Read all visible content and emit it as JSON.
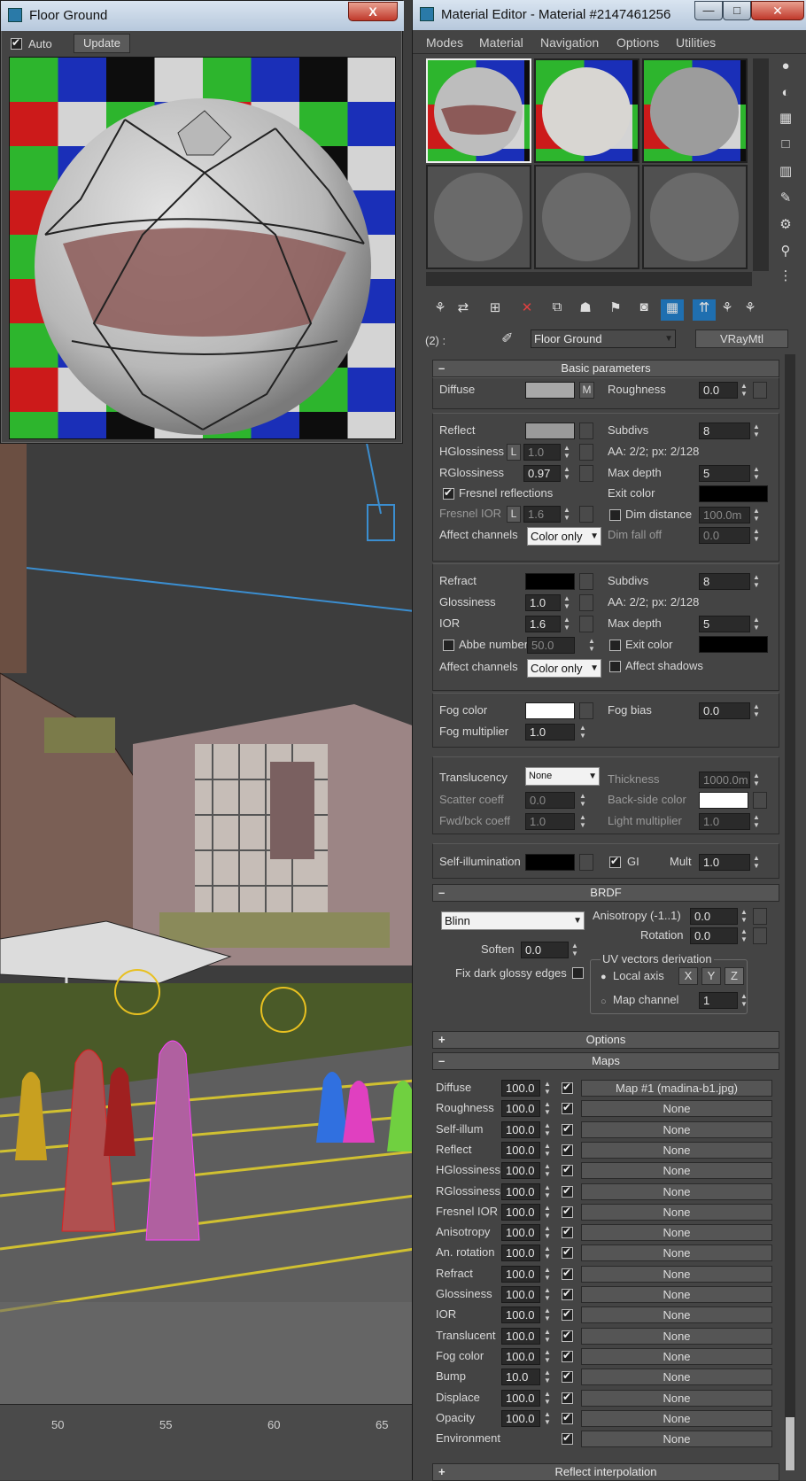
{
  "floor_window": {
    "title": "Floor Ground",
    "close_label": "X",
    "auto_label": "Auto",
    "auto_checked": true,
    "update_label": "Update"
  },
  "material_editor": {
    "title": "Material Editor - Material #2147461256",
    "controls": {
      "minimize": "—",
      "maximize": "□",
      "close": "✕"
    },
    "menu": [
      "Modes",
      "Material",
      "Navigation",
      "Options",
      "Utilities"
    ],
    "slot_label": "(2) :",
    "material_name": "Floor Ground",
    "material_type": "VRayMtl"
  },
  "basic_parameters": {
    "header": "Basic parameters",
    "diffuse": {
      "label": "Diffuse",
      "map_btn": "M",
      "roughness_label": "Roughness",
      "roughness": "0.0"
    },
    "reflect": {
      "label": "Reflect",
      "subdivs_label": "Subdivs",
      "subdivs": "8",
      "hglossiness_label": "HGlossiness",
      "lock": "L",
      "hglossiness": "1.0",
      "aa": "AA: 2/2; px: 2/128",
      "rglossiness_label": "RGlossiness",
      "rglossiness": "0.97",
      "max_depth_label": "Max depth",
      "max_depth": "5",
      "fresnel_label": "Fresnel reflections",
      "fresnel_checked": true,
      "exit_color_label": "Exit color",
      "fresnel_ior_label": "Fresnel IOR",
      "fresnel_ior": "1.6",
      "dim_distance_label": "Dim distance",
      "dim_distance": "100.0m",
      "affect_channels_label": "Affect channels",
      "affect_channels": "Color only",
      "dim_falloff_label": "Dim fall off",
      "dim_falloff": "0.0"
    },
    "refract": {
      "label": "Refract",
      "subdivs_label": "Subdivs",
      "subdivs": "8",
      "glossiness_label": "Glossiness",
      "glossiness": "1.0",
      "aa": "AA: 2/2; px: 2/128",
      "ior_label": "IOR",
      "ior": "1.6",
      "max_depth_label": "Max depth",
      "max_depth": "5",
      "abbe_label": "Abbe number",
      "abbe": "50.0",
      "exit_color_label": "Exit color",
      "affect_channels_label": "Affect channels",
      "affect_channels": "Color only",
      "affect_shadows_label": "Affect shadows"
    },
    "fog": {
      "color_label": "Fog color",
      "bias_label": "Fog bias",
      "bias": "0.0",
      "multiplier_label": "Fog multiplier",
      "multiplier": "1.0"
    },
    "translucency": {
      "label": "Translucency",
      "value": "None",
      "thickness_label": "Thickness",
      "thickness": "1000.0m",
      "scatter_label": "Scatter coeff",
      "scatter": "0.0",
      "backside_label": "Back-side color",
      "fwd_label": "Fwd/bck coeff",
      "fwd": "1.0",
      "light_mult_label": "Light multiplier",
      "light_mult": "1.0"
    },
    "self_illum": {
      "label": "Self-illumination",
      "gi_label": "GI",
      "gi_checked": true,
      "mult_label": "Mult",
      "mult": "1.0"
    }
  },
  "brdf": {
    "header": "BRDF",
    "type": "Blinn",
    "anisotropy_label": "Anisotropy (-1..1)",
    "anisotropy": "0.0",
    "rotation_label": "Rotation",
    "rotation": "0.0",
    "soften_label": "Soften",
    "soften": "0.0",
    "fix_dark_label": "Fix dark glossy edges",
    "uv_label": "UV vectors derivation",
    "local_axis_label": "Local axis",
    "axes": [
      "X",
      "Y",
      "Z"
    ],
    "map_channel_label": "Map channel",
    "map_channel": "1"
  },
  "options": {
    "header": "Options"
  },
  "maps": {
    "header": "Maps",
    "rows": [
      {
        "name": "Diffuse",
        "amount": "100.0",
        "map": "Map #1 (madina-b1.jpg)"
      },
      {
        "name": "Roughness",
        "amount": "100.0",
        "map": "None"
      },
      {
        "name": "Self-illum",
        "amount": "100.0",
        "map": "None"
      },
      {
        "name": "Reflect",
        "amount": "100.0",
        "map": "None"
      },
      {
        "name": "HGlossiness",
        "amount": "100.0",
        "map": "None"
      },
      {
        "name": "RGlossiness",
        "amount": "100.0",
        "map": "None"
      },
      {
        "name": "Fresnel IOR",
        "amount": "100.0",
        "map": "None"
      },
      {
        "name": "Anisotropy",
        "amount": "100.0",
        "map": "None"
      },
      {
        "name": "An. rotation",
        "amount": "100.0",
        "map": "None"
      },
      {
        "name": "Refract",
        "amount": "100.0",
        "map": "None"
      },
      {
        "name": "Glossiness",
        "amount": "100.0",
        "map": "None"
      },
      {
        "name": "IOR",
        "amount": "100.0",
        "map": "None"
      },
      {
        "name": "Translucent",
        "amount": "100.0",
        "map": "None"
      },
      {
        "name": "Fog color",
        "amount": "100.0",
        "map": "None"
      },
      {
        "name": "Bump",
        "amount": "10.0",
        "map": "None"
      },
      {
        "name": "Displace",
        "amount": "100.0",
        "map": "None"
      },
      {
        "name": "Opacity",
        "amount": "100.0",
        "map": "None"
      },
      {
        "name": "Environment",
        "amount": "",
        "map": "None"
      }
    ]
  },
  "reflect_interp": {
    "header": "Reflect interpolation"
  },
  "ruler": [
    "50",
    "55",
    "60",
    "65"
  ],
  "colors": {
    "accent": "#1f8fd8",
    "panel": "#444444",
    "field": "#2a2a2a"
  }
}
